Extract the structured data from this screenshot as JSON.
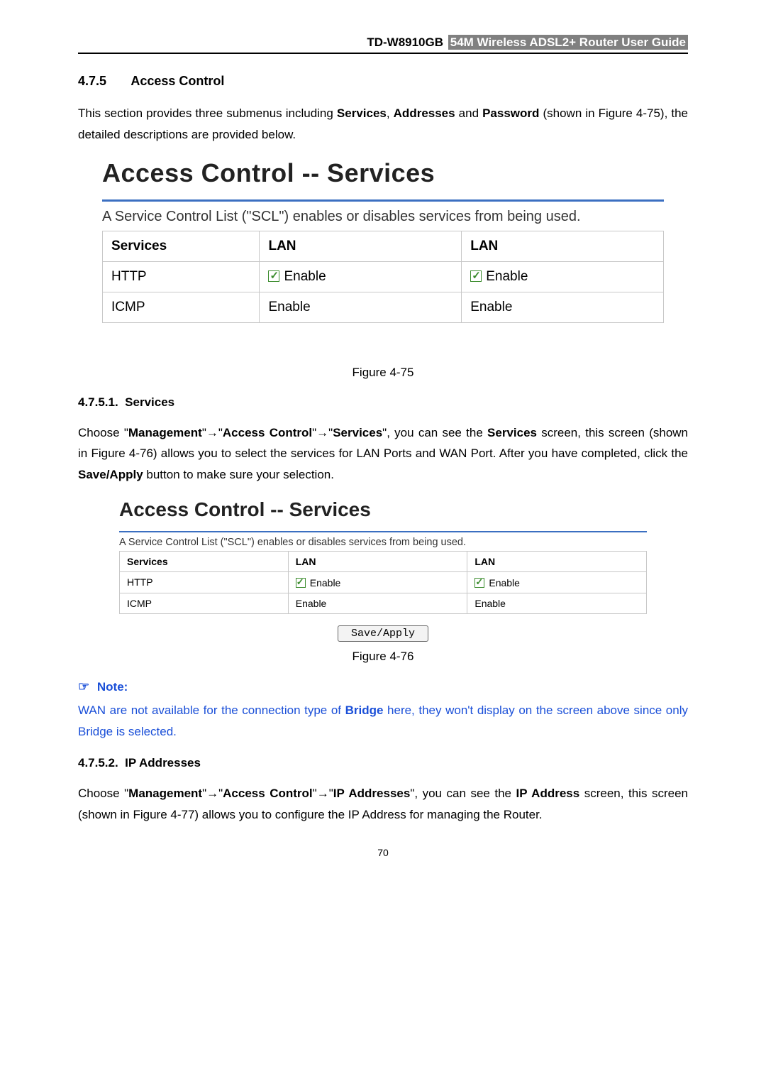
{
  "header": {
    "model": "TD-W8910GB",
    "title": "54M Wireless ADSL2+ Router User Guide"
  },
  "section": {
    "number": "4.7.5",
    "title": "Access Control",
    "intro_pre": "This section provides three submenus including ",
    "intro_b1": "Services",
    "intro_sep1": ", ",
    "intro_b2": "Addresses",
    "intro_sep2": " and ",
    "intro_b3": "Password",
    "intro_post": " (shown in Figure 4-75), the detailed descriptions are provided below."
  },
  "fig1": {
    "title": "Access Control -- Services",
    "desc": "A Service Control List (\"SCL\") enables or disables services from being used.",
    "headers": [
      "Services",
      "LAN",
      "LAN"
    ],
    "rows": [
      {
        "svc": "HTTP",
        "c2_label": "Enable",
        "c2_chk": true,
        "c3_label": "Enable",
        "c3_chk": true
      },
      {
        "svc": "ICMP",
        "c2_label": "Enable",
        "c2_chk": false,
        "c3_label": "Enable",
        "c3_chk": false
      }
    ],
    "caption": "Figure 4-75"
  },
  "sub1": {
    "number": "4.7.5.1.",
    "title": "Services",
    "p_pre": "Choose \"",
    "p_b1": "Management",
    "p_arr1": "\"→\"",
    "p_b2": "Access Control",
    "p_arr2": "\"→\"",
    "p_b3": "Services",
    "p_mid1": "\", you can see the ",
    "p_b4": "Services",
    "p_mid2": " screen, this screen (shown in Figure 4-76) allows you to select the services for LAN Ports and WAN Port. After you have completed, click the ",
    "p_b5": "Save/Apply",
    "p_post": " button to make sure your selection."
  },
  "fig2": {
    "title": "Access Control -- Services",
    "desc": "A Service Control List (\"SCL\") enables or disables services from being used.",
    "headers": [
      "Services",
      "LAN",
      "LAN"
    ],
    "rows": [
      {
        "svc": "HTTP",
        "c2_label": "Enable",
        "c2_chk": true,
        "c3_label": "Enable",
        "c3_chk": true
      },
      {
        "svc": "ICMP",
        "c2_label": "Enable",
        "c2_chk": false,
        "c3_label": "Enable",
        "c3_chk": false
      }
    ],
    "button": "Save/Apply",
    "caption": "Figure 4-76"
  },
  "note": {
    "label": "Note:",
    "body_pre": "WAN are not available for the connection type of ",
    "body_b": "Bridge",
    "body_post": " here, they won't display on the screen above since only Bridge is selected."
  },
  "sub2": {
    "number": "4.7.5.2.",
    "title": "IP Addresses",
    "p_pre": "Choose \"",
    "p_b1": "Management",
    "p_arr1": "\"→\"",
    "p_b2": "Access Control",
    "p_arr2": "\"→\"",
    "p_b3": "IP Addresses",
    "p_mid1": "\", you can see the ",
    "p_b4": "IP Address",
    "p_post": " screen, this screen (shown in Figure 4-77) allows you to configure the IP Address for managing the Router."
  },
  "pagenum": "70"
}
